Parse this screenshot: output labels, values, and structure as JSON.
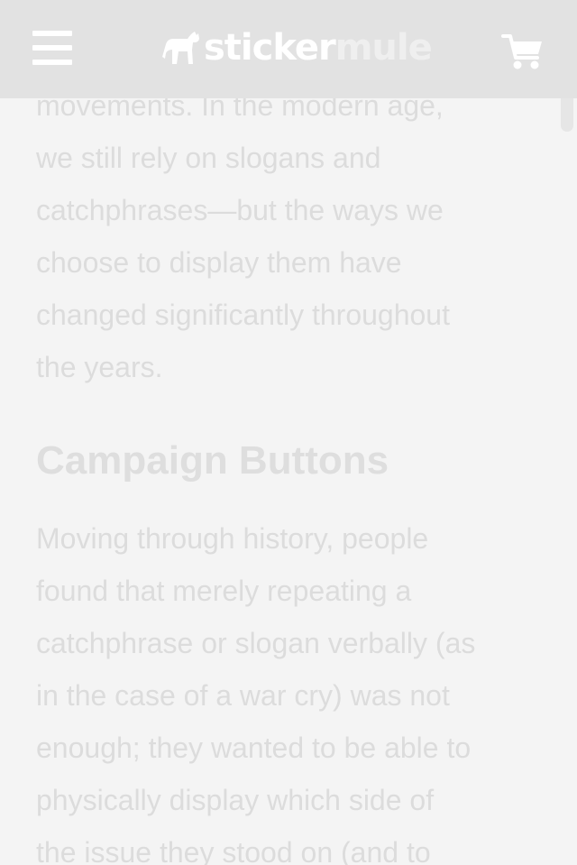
{
  "header": {
    "logo_part1": "sticker",
    "logo_part2": "mule",
    "menu_icon": "hamburger-menu-icon",
    "cart_icon": "shopping-cart-icon",
    "background": "#e2e2e2"
  },
  "article": {
    "intro_lines": [
      "movements. In the modern age,",
      "we still rely on slogans and",
      "catchphrases—but the ways we",
      "choose to display them have",
      "changed significantly throughout",
      "the years."
    ],
    "heading": "Campaign Buttons",
    "body_lines": [
      "Moving through history, people",
      "found that merely repeating a",
      "catchphrase or slogan verbally (as",
      "in the case of a war cry) was not",
      "enough; they wanted to be able to",
      "physically display which side of",
      "the issue they stood on (and to"
    ]
  }
}
